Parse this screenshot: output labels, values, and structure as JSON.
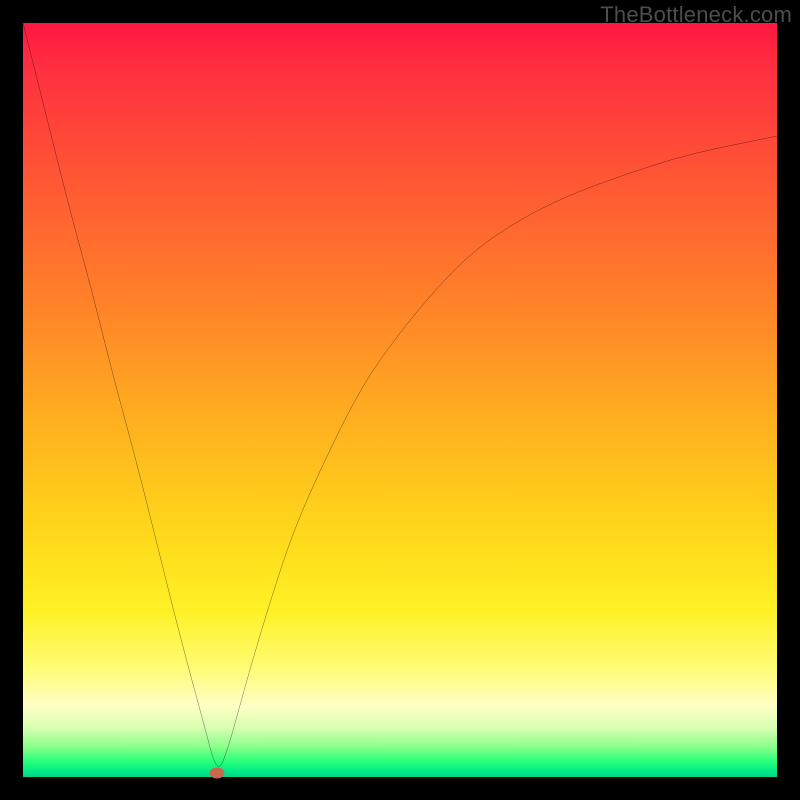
{
  "watermark": "TheBottleneck.com",
  "chart_data": {
    "type": "line",
    "title": "",
    "xlabel": "",
    "ylabel": "",
    "xlim": [
      0,
      100
    ],
    "ylim": [
      0,
      100
    ],
    "grid": false,
    "legend": false,
    "background_gradient": {
      "direction": "vertical",
      "stops": [
        {
          "pos": 0.0,
          "color": "#ff1840"
        },
        {
          "pos": 0.4,
          "color": "#ff8a27"
        },
        {
          "pos": 0.78,
          "color": "#fff126"
        },
        {
          "pos": 0.93,
          "color": "#d7ffb0"
        },
        {
          "pos": 1.0,
          "color": "#00d48a"
        }
      ]
    },
    "series": [
      {
        "name": "bottleneck-curve",
        "color": "#000000",
        "x": [
          0,
          3,
          6,
          9,
          12,
          15,
          18,
          21,
          24,
          25.7,
          27,
          30,
          33,
          36,
          40,
          45,
          50,
          55,
          60,
          66,
          72,
          80,
          88,
          95,
          100
        ],
        "y": [
          100,
          88,
          76,
          65,
          53,
          42,
          30,
          18,
          7,
          0.5,
          3,
          14,
          24,
          33,
          42,
          52,
          59,
          65,
          70,
          74,
          77,
          80,
          82.5,
          84,
          85
        ]
      }
    ],
    "marker": {
      "name": "optimum-point",
      "x": 25.7,
      "y": 0.5,
      "color": "#c56a4e"
    }
  }
}
